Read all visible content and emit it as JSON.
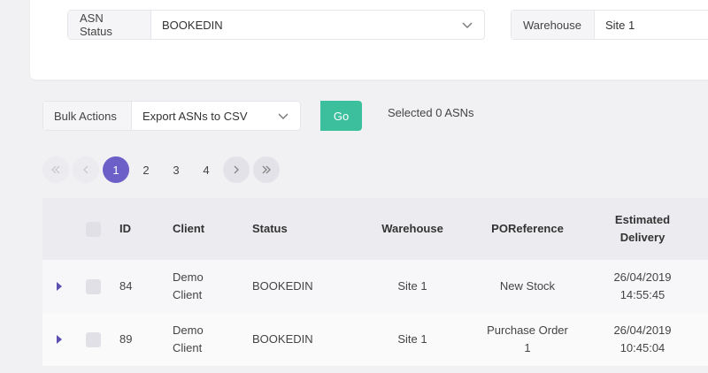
{
  "filters": {
    "asn_status_label": "ASN Status",
    "asn_status_value": "BOOKEDIN",
    "warehouse_label": "Warehouse",
    "warehouse_value": "Site 1"
  },
  "bulk": {
    "label": "Bulk Actions",
    "value": "Export ASNs to CSV",
    "go_label": "Go",
    "selected_text": "Selected 0 ASNs"
  },
  "pagination": {
    "pages": [
      "1",
      "2",
      "3",
      "4"
    ],
    "current": "1"
  },
  "table": {
    "headers": {
      "id": "ID",
      "client": "Client",
      "status": "Status",
      "warehouse": "Warehouse",
      "poreference": "POReference",
      "estimated_delivery_1": "Estimated",
      "estimated_delivery_2": "Delivery"
    },
    "rows": [
      {
        "id": "84",
        "client_1": "Demo",
        "client_2": "Client",
        "status": "BOOKEDIN",
        "warehouse": "Site 1",
        "po_1": "New Stock",
        "po_2": "",
        "date": "26/04/2019",
        "time": "14:55:45"
      },
      {
        "id": "89",
        "client_1": "Demo",
        "client_2": "Client",
        "status": "BOOKEDIN",
        "warehouse": "Site 1",
        "po_1": "Purchase Order",
        "po_2": "1",
        "date": "26/04/2019",
        "time": "10:45:04"
      }
    ]
  }
}
